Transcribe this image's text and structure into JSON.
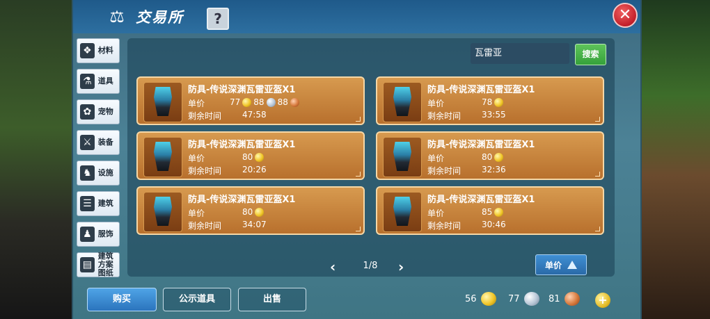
{
  "title": "交易所",
  "help_label": "?",
  "close_label": "✕",
  "sidebar": {
    "items": [
      {
        "label": "材料",
        "icon": "materials-icon",
        "glyph": "❖"
      },
      {
        "label": "道具",
        "icon": "potion-icon",
        "glyph": "⚗"
      },
      {
        "label": "宠物",
        "icon": "paw-icon",
        "glyph": "✿"
      },
      {
        "label": "装备",
        "icon": "sword-icon",
        "glyph": "⚔"
      },
      {
        "label": "设施",
        "icon": "facility-icon",
        "glyph": "♞"
      },
      {
        "label": "建筑",
        "icon": "building-icon",
        "glyph": "☰"
      },
      {
        "label": "服饰",
        "icon": "clothing-icon",
        "glyph": "♟"
      },
      {
        "label": "建筑方案图纸",
        "icon": "blueprint-icon",
        "glyph": "▤"
      }
    ]
  },
  "search": {
    "value": "瓦雷亚",
    "button_label": "搜索"
  },
  "listings": [
    {
      "name": "防具-传说深渊瓦雷亚盔X1",
      "price_label": "单价",
      "price_gold": "77",
      "price_silver": "88",
      "price_copper": "88",
      "time_label": "剩余时间",
      "time": "47:58"
    },
    {
      "name": "防具-传说深渊瓦雷亚盔X1",
      "price_label": "单价",
      "price_gold": "78",
      "time_label": "剩余时间",
      "time": "33:55"
    },
    {
      "name": "防具-传说深渊瓦雷亚盔X1",
      "price_label": "单价",
      "price_gold": "80",
      "time_label": "剩余时间",
      "time": "20:26"
    },
    {
      "name": "防具-传说深渊瓦雷亚盔X1",
      "price_label": "单价",
      "price_gold": "80",
      "time_label": "剩余时间",
      "time": "32:36"
    },
    {
      "name": "防具-传说深渊瓦雷亚盔X1",
      "price_label": "单价",
      "price_gold": "80",
      "time_label": "剩余时间",
      "time": "34:07"
    },
    {
      "name": "防具-传说深渊瓦雷亚盔X1",
      "price_label": "单价",
      "price_gold": "85",
      "time_label": "剩余时间",
      "time": "30:46"
    }
  ],
  "pagination": {
    "text": "1/8",
    "prev": "‹",
    "next": "›"
  },
  "sort_button_label": "单价",
  "bottom_tabs": {
    "buy": "购买",
    "public": "公示道具",
    "sell": "出售"
  },
  "currency": {
    "gold": "56",
    "silver": "77",
    "copper": "81"
  },
  "add_label": "+",
  "colors": {
    "gold": "#f1c628",
    "silver": "#b7c6d6",
    "copper": "#d77a3d",
    "accent": "#2b74bd",
    "search_green": "#35a13a"
  }
}
